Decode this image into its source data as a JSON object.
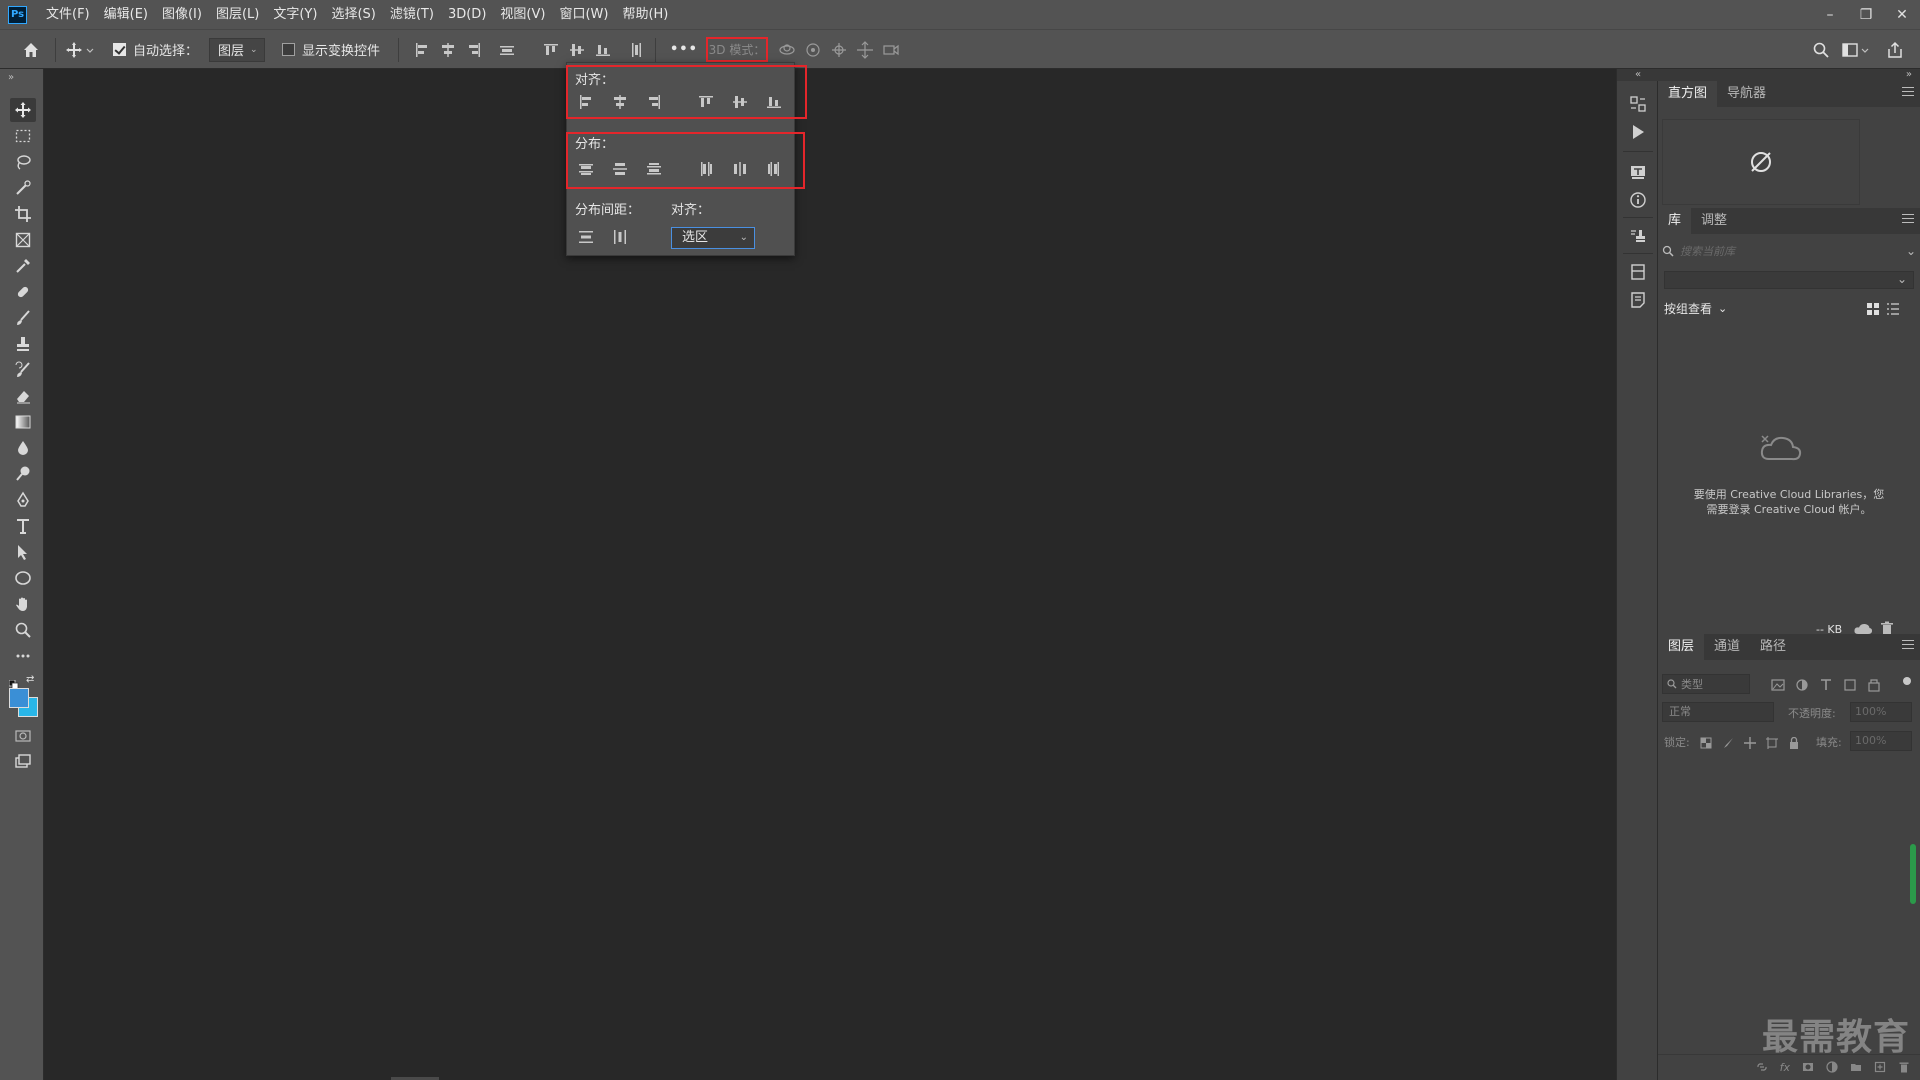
{
  "app": {
    "logo_text": "Ps"
  },
  "menu": [
    "文件(F)",
    "编辑(E)",
    "图像(I)",
    "图层(L)",
    "文字(Y)",
    "选择(S)",
    "滤镜(T)",
    "3D(D)",
    "视图(V)",
    "窗口(W)",
    "帮助(H)"
  ],
  "window_controls": {
    "minimize": "–",
    "restore": "❐",
    "close": "✕"
  },
  "options": {
    "auto_select_label": "自动选择：",
    "auto_select_checked": true,
    "auto_select_target": "图层",
    "show_transform_label": "显示变换控件",
    "show_transform_checked": false,
    "more_label": "•••",
    "mode_3d_label": "3D 模式："
  },
  "popup": {
    "align_label": "对齐：",
    "distribute_label": "分布：",
    "distribute_spacing_label": "分布间距：",
    "align_to_label": "对齐：",
    "align_to_value": "选区"
  },
  "panels": {
    "top_tabs": [
      "直方图",
      "导航器"
    ],
    "library_tabs": [
      "库",
      "调整"
    ],
    "library_search_placeholder": "搜索当前库",
    "group_view_label": "按组查看",
    "library_message_line1": "要使用 Creative Cloud Libraries，您",
    "library_message_line2": "需要登录 Creative Cloud 帐户。",
    "library_size": "-- KB",
    "layers_tabs": [
      "图层",
      "通道",
      "路径"
    ],
    "layers_filter_placeholder": "类型",
    "blend_mode": "正常",
    "opacity_label": "不透明度:",
    "opacity_value": "100%",
    "lock_label": "锁定:",
    "fill_label": "填充:",
    "fill_value": "100%"
  },
  "watermark": "最需教育",
  "colors": {
    "highlight_red": "#e4262b",
    "foreground": "#3a8fd6",
    "background": "#29b6e8"
  }
}
